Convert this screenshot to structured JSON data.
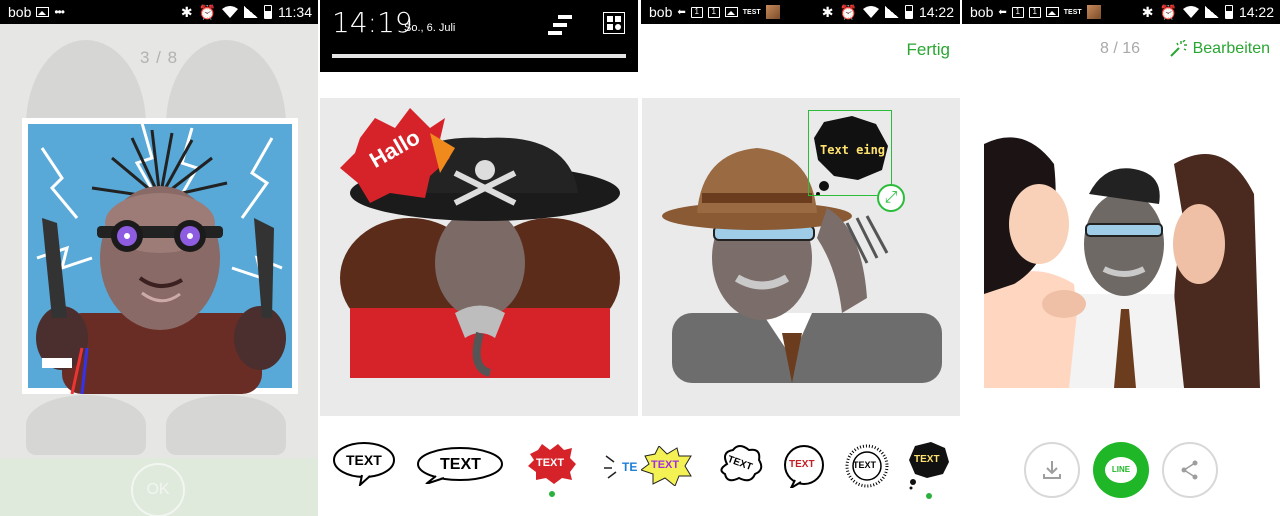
{
  "panel1": {
    "status": {
      "carrier": "bob",
      "time": "11:34",
      "dots": "•••"
    },
    "counter": "3 / 8",
    "ok_label": "OK"
  },
  "panel2": {
    "notification": {
      "time": "14:19",
      "date": "So., 6. Juli"
    },
    "sticker_text": "Hallo",
    "bubbles": [
      {
        "label": "TEXT",
        "style": "round-outline",
        "selected": false
      },
      {
        "label": "TEXT",
        "style": "wide-outline",
        "selected": false
      },
      {
        "label": "TEXT",
        "style": "red-burst",
        "selected": true
      },
      {
        "label": "TE",
        "style": "blue-partial",
        "selected": false
      },
      {
        "label": "TEXT",
        "style": "yellow-burst",
        "selected": false
      },
      {
        "label": "TEXT",
        "style": "cloud",
        "selected": false
      },
      {
        "label": "TEXT",
        "style": "round-red-text",
        "selected": false
      },
      {
        "label": "TEXT",
        "style": "dotted-circle",
        "selected": false
      },
      {
        "label": "TEXT",
        "style": "black-blob",
        "selected": true
      }
    ]
  },
  "panel3": {
    "status": {
      "carrier": "bob",
      "time": "14:22",
      "tst": "TEST"
    },
    "done_label": "Fertig",
    "sticker_text": "Text eing"
  },
  "panel4": {
    "status": {
      "carrier": "bob",
      "time": "14:22",
      "tst": "TEST"
    },
    "counter": "8 / 16",
    "edit_label": "Bearbeiten",
    "line_label": "LINE"
  },
  "colors": {
    "accent": "#2aa632",
    "line_green": "#1fb628",
    "status_bar": "#000000"
  }
}
